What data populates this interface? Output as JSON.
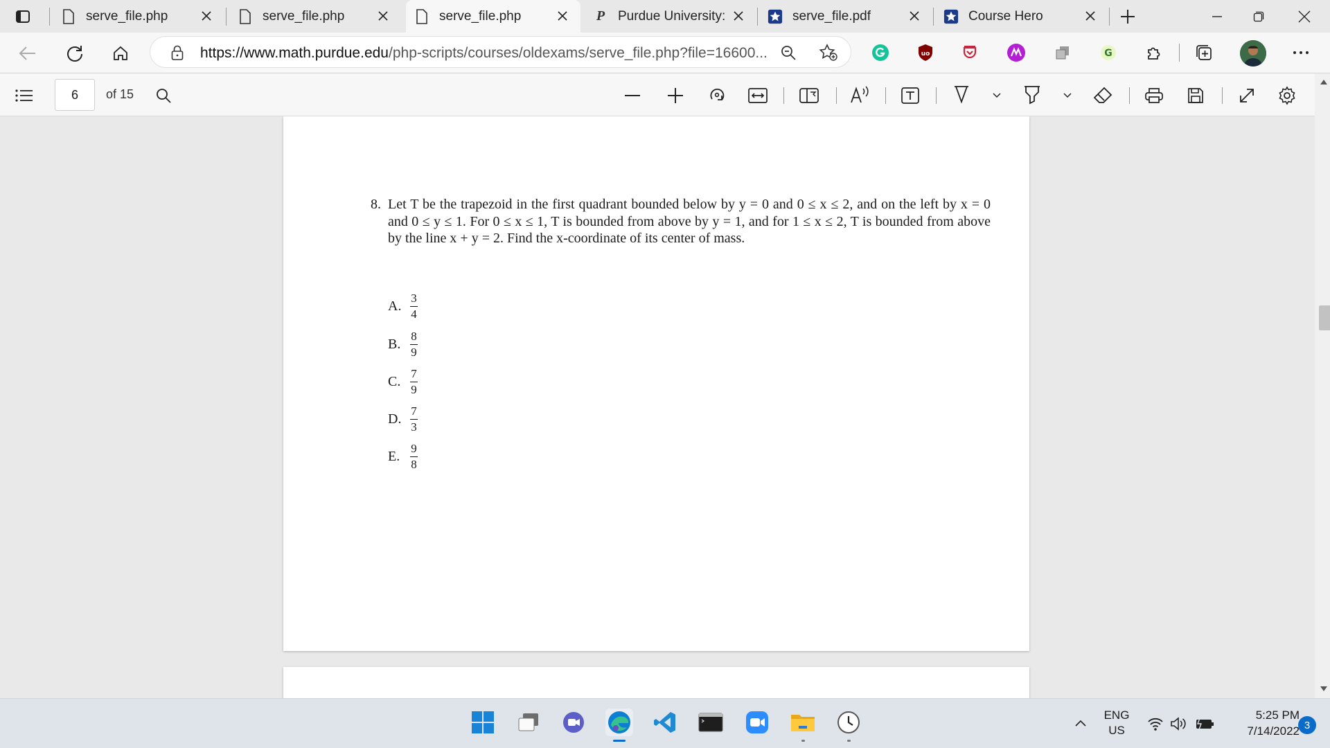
{
  "tabs": [
    {
      "title": "serve_file.php",
      "icon": "file-icon"
    },
    {
      "title": "serve_file.php",
      "icon": "file-icon"
    },
    {
      "title": "serve_file.php",
      "icon": "file-icon",
      "active": true
    },
    {
      "title": "Purdue University: D",
      "icon": "purdue-logo-icon"
    },
    {
      "title": "serve_file.pdf",
      "icon": "star-badge-icon"
    },
    {
      "title": "Course Hero",
      "icon": "star-badge-icon"
    }
  ],
  "address": {
    "url_host": "https://www.math.purdue.edu",
    "url_path": "/php-scripts/courses/oldexams/serve_file.php?file=16600..."
  },
  "pdf_toolbar": {
    "page_current": "6",
    "page_total_label": "of 15"
  },
  "question": {
    "number": "8.",
    "text": "Let T be the trapezoid in the first quadrant bounded below by y = 0 and 0 ≤ x ≤ 2, and on the left by x = 0 and 0 ≤ y ≤ 1. For 0 ≤ x ≤ 1, T is bounded from above by y = 1, and for 1 ≤ x ≤ 2, T is bounded from above by the line x + y = 2. Find the x-coordinate of its center of mass.",
    "options": [
      {
        "label": "A.",
        "num": "3",
        "den": "4"
      },
      {
        "label": "B.",
        "num": "8",
        "den": "9"
      },
      {
        "label": "C.",
        "num": "7",
        "den": "9"
      },
      {
        "label": "D.",
        "num": "7",
        "den": "3"
      },
      {
        "label": "E.",
        "num": "9",
        "den": "8"
      }
    ]
  },
  "taskbar": {
    "lang_top": "ENG",
    "lang_bottom": "US",
    "time": "5:25 PM",
    "date": "7/14/2022",
    "notification_count": "3"
  },
  "colors": {
    "edge_blue": "#0b6bcb",
    "grammarly_green": "#15c39a",
    "ublock_red": "#800000"
  }
}
